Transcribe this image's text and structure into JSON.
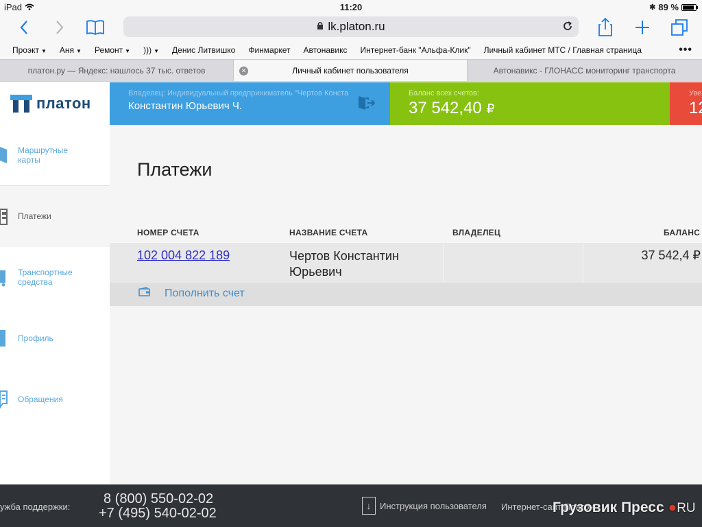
{
  "status_bar": {
    "device": "iPad",
    "time": "11:20",
    "battery": "89 %",
    "battery_level": 0.89
  },
  "toolbar": {
    "url": "lk.platon.ru"
  },
  "bookmarks": [
    {
      "label": "Проэкт",
      "folder": true
    },
    {
      "label": "Аня",
      "folder": true
    },
    {
      "label": "Ремонт",
      "folder": true
    },
    {
      "label": ")))",
      "folder": true
    },
    {
      "label": "Денис Литвишко",
      "folder": false
    },
    {
      "label": "Финмаркет",
      "folder": false
    },
    {
      "label": "Автонавикс",
      "folder": false
    },
    {
      "label": "Интернет-банк \"Альфа-Клик\"",
      "folder": false
    },
    {
      "label": "Личный кабинет МТС / Главная страница",
      "folder": false
    }
  ],
  "tabs": [
    {
      "label": "платон.ру — Яндекс: нашлось 37 тыс. ответов"
    },
    {
      "label": "Личный кабинет пользователя"
    },
    {
      "label": "Автонавикс - ГЛОНАСС мониторинг транспорта"
    }
  ],
  "header": {
    "logo": "платон",
    "owner_label": "Владелец: Индивидуальный предприниматель \"Чертов Конста",
    "owner_name": "Константин Юрьевич Ч.",
    "balance_label": "Баланс всех счетов:",
    "balance_value": "37 542,40",
    "currency": "₽",
    "third_label": "Уве",
    "third_value": "12"
  },
  "sidebar": {
    "items": [
      {
        "label": "Маршрутные карты",
        "icon": "route-card-icon"
      },
      {
        "label": "Платежи",
        "icon": "payments-icon",
        "active": true
      },
      {
        "label": "Транспортные средства",
        "icon": "vehicle-icon"
      },
      {
        "label": "Профиль",
        "icon": "profile-icon"
      },
      {
        "label": "Обращения",
        "icon": "requests-icon"
      }
    ]
  },
  "main": {
    "title": "Платежи",
    "columns": [
      "НОМЕР СЧЕТА",
      "НАЗВАНИЕ СЧЕТА",
      "ВЛАДЕЛЕЦ",
      "БАЛАНС"
    ],
    "rows": [
      {
        "account_number": "102 004 822 189",
        "account_name": "Чертов Константин Юрьевич",
        "owner": "",
        "balance": "37 542,4 ₽"
      }
    ],
    "topup_label": "Пополнить счет"
  },
  "footer": {
    "support_label": "ужба поддержки:",
    "phone1": "8 (800) 550-02-02",
    "phone2": "+7 (495) 540-02-02",
    "instruction": "Инструкция пользователя",
    "site": "Интернет-сайт Платон",
    "watermark_main": "Грузовик Пресс",
    "watermark_tld": "RU"
  }
}
